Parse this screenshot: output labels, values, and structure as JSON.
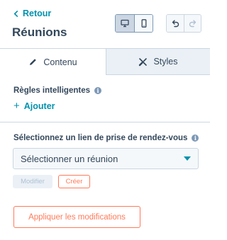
{
  "header": {
    "back_label": "Retour",
    "title": "Réunions",
    "device_buttons": [
      {
        "icon": "desktop-icon",
        "active": true
      },
      {
        "icon": "mobile-icon",
        "active": false
      }
    ],
    "history_buttons": [
      {
        "icon": "undo-icon",
        "enabled": true
      },
      {
        "icon": "redo-icon",
        "enabled": false
      }
    ]
  },
  "tabs": [
    {
      "label": "Contenu",
      "icon": "pencil-icon",
      "active": true
    },
    {
      "label": "Styles",
      "icon": "styles-icon",
      "active": false
    }
  ],
  "smart_rules": {
    "label": "Règles intelligentes",
    "add_label": "Ajouter"
  },
  "meeting_link": {
    "label": "Sélectionnez un lien de prise de rendez-vous",
    "select_value": "Sélectionner un réunion",
    "edit_label": "Modifier",
    "create_label": "Créer"
  },
  "apply_label": "Appliquer les modifications",
  "colors": {
    "link": "#0091ae",
    "accent": "#ff7a59",
    "text": "#33475b",
    "border": "#cbd6e2"
  }
}
